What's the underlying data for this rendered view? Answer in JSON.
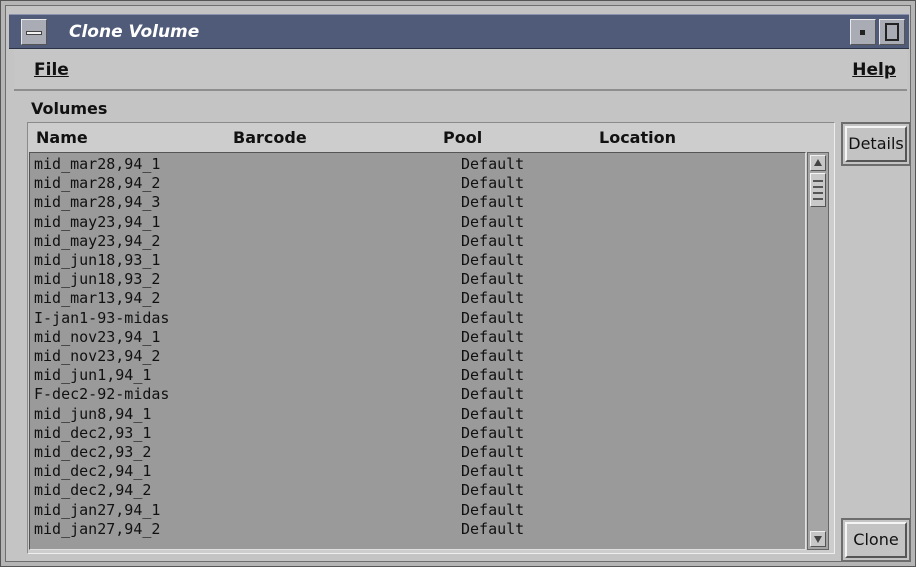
{
  "window": {
    "title": "Clone Volume"
  },
  "menu": {
    "file_label": "File",
    "help_label": "Help"
  },
  "volumes": {
    "section_label": "Volumes",
    "columns": [
      "Name",
      "Barcode",
      "Pool",
      "Location"
    ],
    "rows": [
      {
        "name": "mid_mar28,94_1",
        "pool": "Default"
      },
      {
        "name": "mid_mar28,94_2",
        "pool": "Default"
      },
      {
        "name": "mid_mar28,94_3",
        "pool": "Default"
      },
      {
        "name": "mid_may23,94_1",
        "pool": "Default"
      },
      {
        "name": "mid_may23,94_2",
        "pool": "Default"
      },
      {
        "name": "mid_jun18,93_1",
        "pool": "Default"
      },
      {
        "name": "mid_jun18,93_2",
        "pool": "Default"
      },
      {
        "name": "mid_mar13,94_2",
        "pool": "Default"
      },
      {
        "name": "I-jan1-93-midas",
        "pool": "Default"
      },
      {
        "name": "mid_nov23,94_1",
        "pool": "Default"
      },
      {
        "name": "mid_nov23,94_2",
        "pool": "Default"
      },
      {
        "name": "mid_jun1,94_1",
        "pool": "Default"
      },
      {
        "name": "F-dec2-92-midas",
        "pool": "Default"
      },
      {
        "name": "mid_jun8,94_1",
        "pool": "Default"
      },
      {
        "name": "mid_dec2,93_1",
        "pool": "Default"
      },
      {
        "name": "mid_dec2,93_2",
        "pool": "Default"
      },
      {
        "name": "mid_dec2,94_1",
        "pool": "Default"
      },
      {
        "name": "mid_dec2,94_2",
        "pool": "Default"
      },
      {
        "name": "mid_jan27,94_1",
        "pool": "Default"
      },
      {
        "name": "mid_jan27,94_2",
        "pool": "Default"
      }
    ]
  },
  "buttons": {
    "details_label": "Details",
    "clone_label": "Clone"
  },
  "icons": {
    "window_menu": "window-menu-icon",
    "minimize": "minimize-icon",
    "maximize": "maximize-icon",
    "scroll_up": "arrow-up-icon",
    "scroll_down": "arrow-down-icon"
  }
}
